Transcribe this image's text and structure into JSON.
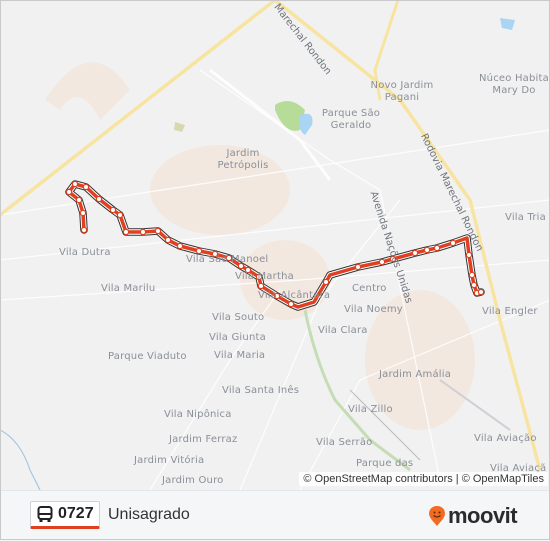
{
  "map": {
    "places": [
      "Novo Jardim Pagani",
      "Núceo Habita Mary Do",
      "Parque São Geraldo",
      "Jardim Petrópolis",
      "Vila Tria",
      "Vila Dutra",
      "Vila São Manoel",
      "Vila Martha",
      "Vila Marilu",
      "Vila Alcântara",
      "Centro",
      "Vila Noemy",
      "Vila Engler",
      "Vila Souto",
      "Vila Clara",
      "Vila Giunta",
      "Parque Viaduto",
      "Vila Maria",
      "Jardim Amália",
      "Vila Santa Inês",
      "Vila Zillo",
      "Vila Nipônica",
      "Jardim Ferraz",
      "Vila Serrão",
      "Vila Aviação",
      "Jardim Vitória",
      "Parque das",
      "Vila Aviaçã",
      "Jardim Ouro"
    ],
    "roads": [
      "Marechal Rondon",
      "Rodovia Marechal Rondon",
      "Avenida Nações Unidas"
    ],
    "attribution": "© OpenStreetMap contributors | © OpenMapTiles",
    "route_color": "#e0401f"
  },
  "footer": {
    "route_number": "0727",
    "route_name": "Unisagrado",
    "icon": "bus-icon",
    "brand": "moovit",
    "brand_color": "#f26b21"
  }
}
